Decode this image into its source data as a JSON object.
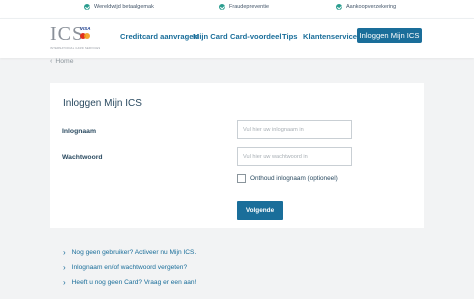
{
  "usp": [
    {
      "text": "Wereldwijd betaalgemak"
    },
    {
      "text": "Fraudepreventie"
    },
    {
      "text": "Aankoopverzekering"
    }
  ],
  "logo": {
    "text": "ICS",
    "visa": "VISA",
    "tagline": "INTERNATIONAL CARD SERVICES"
  },
  "nav": {
    "items": [
      "Creditcard aanvragen",
      "Mijn Card",
      "Card-voordeel",
      "Tips",
      "Klantenservice"
    ],
    "login_button": "Inloggen Mijn ICS"
  },
  "breadcrumb": {
    "label": "Home"
  },
  "form": {
    "title": "Inloggen Mijn ICS",
    "username_label": "Inlognaam",
    "username_placeholder": "Vul hier uw inlognaam in",
    "password_label": "Wachtwoord",
    "password_placeholder": "Vul hier uw wachtwoord in",
    "remember_label": "Onthoud inlognaam (optioneel)",
    "next_button": "Volgende"
  },
  "links": [
    "Nog geen gebruiker? Activeer nu Mijn ICS.",
    "Inlognaam en/of wachtwoord vergeten?",
    "Heeft u nog geen Card? Vraag er een aan!"
  ],
  "colors": {
    "brand": "#1a6e9a",
    "check": "#2a9d8f",
    "background": "#f2f3f4"
  }
}
